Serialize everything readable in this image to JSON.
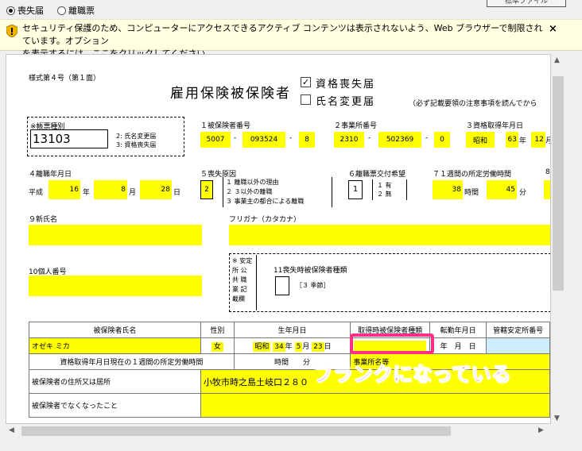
{
  "top": {
    "radio1": "喪失届",
    "radio2": "離職票",
    "button_label": "標準ファイル"
  },
  "infobar": {
    "line1": "セキュリティ保護のため、コンピューターにアクセスできるアクティブ コンテンツは表示されないよう、Web ブラウザーで制限されています。オプション",
    "line2": "を表示するには、ここをクリックしてください...",
    "close": "×"
  },
  "form": {
    "form_no": "様式第４号（第１面）",
    "title": "雇用保険被保険者",
    "check1_label": "資格喪失届",
    "check2_label": "氏名変更届",
    "note": "（必ず記載要領の注意事項を読んでから",
    "chohyo_label": "※帳票種別",
    "chohyo_value": "13103",
    "chohyo_opt1": "2: 氏名変更届",
    "chohyo_opt2": "3: 資格喪失届",
    "h_hihoken_no": "１被保険者番号",
    "hihoken_no": [
      "5007",
      "093524",
      "8"
    ],
    "h_jigyosho_no": "２事業所番号",
    "jigyosho_no": [
      "2310",
      "502369",
      "0"
    ],
    "h_shikaku_date": "３資格取得年月日",
    "shikaku_era": "昭和",
    "shikaku_year": "63",
    "nen": "年",
    "shikaku_month": "12",
    "h_rishoku_date": "４離職年月日",
    "rishoku_era": "平成",
    "rishoku_year": "16",
    "rishoku_month": "8",
    "tsuki": "月",
    "rishoku_day": "28",
    "hi": "日",
    "h_soshitsu": "５喪失原因",
    "soshitsu_value": "2",
    "soshitsu_opt1": "１ 離職以外の理由",
    "soshitsu_opt2": "２ ３以外の離職",
    "soshitsu_opt3": "３ 事業主の都合による離職",
    "h_rishokuhyo": "６離職票交付希望",
    "rishokuhyo_value": "1",
    "rishokuhyo_opt1": "１ 有",
    "rishokuhyo_opt2": "２ 無",
    "h_rodo": "７１週間の所定労働時間",
    "rodo_hours": "38",
    "jikan": "時間",
    "rodo_minutes": "45",
    "fun": "分",
    "h_next": "8",
    "h_new_name": "９新氏名",
    "h_furigana": "フリガナ（カタカナ）",
    "h_kojin": "10個人番号",
    "antei_label": "※ 安定所 公共 職業 記載欄",
    "h_kisetsu": "11喪失時被保険者種類",
    "kisetsu_note": "［３ 季節］"
  },
  "table": {
    "headers": [
      "被保険者氏名",
      "性別",
      "生年月日",
      "取得時被保険者種類",
      "転勤年月日",
      "管轄安定所番号"
    ],
    "name": "オゼキ ミカ",
    "sex": "女",
    "birth_era": "昭和",
    "birth_year": "34",
    "birth_month": "5",
    "birth_day": "23",
    "tenkin_year_label": "年",
    "tenkin_month_label": "月",
    "tenkin_day_label": "日",
    "row2_label": "資格取得年月日現在の１週間の所定労働時間",
    "row2_hours_label": "時間",
    "row2_minutes_label": "分",
    "row2_jigyosho_label": "事業所名等",
    "row3_label": "被保険者の住所又は居所",
    "row3_value": "小牧市時之島土岐口２８０",
    "row4_label": "被保険者でなくなったこと"
  },
  "annotation": "ブランクになっている"
}
